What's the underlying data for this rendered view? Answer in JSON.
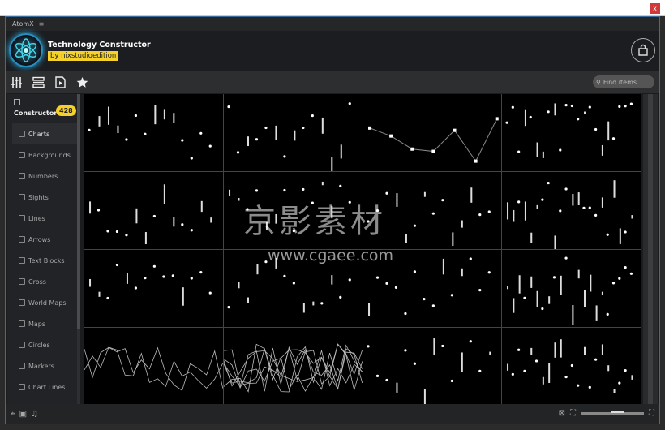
{
  "window": {
    "app_name": "AtomX",
    "menu_icon": "hamburger-icon",
    "close_label": "x"
  },
  "header": {
    "title": "Technology Constructor",
    "byline": "by nixstudioedition",
    "cart_icon": "shopping-bag-icon"
  },
  "toolbar": {
    "icons": [
      "sliders-icon",
      "list-icon",
      "media-file-icon",
      "star-icon"
    ],
    "search_placeholder": "Find items"
  },
  "sidebar": {
    "section": "Constructor",
    "count": "428",
    "items": [
      {
        "label": "Charts",
        "active": true
      },
      {
        "label": "Backgrounds"
      },
      {
        "label": "Numbers"
      },
      {
        "label": "Sights"
      },
      {
        "label": "Lines"
      },
      {
        "label": "Arrows"
      },
      {
        "label": "Text Blocks"
      },
      {
        "label": "Cross"
      },
      {
        "label": "World Maps"
      },
      {
        "label": "Maps"
      },
      {
        "label": "Circles"
      },
      {
        "label": "Markers"
      },
      {
        "label": "Chart Lines"
      }
    ]
  },
  "watermark": {
    "text": "京影素材",
    "url": "www.cgaee.com"
  },
  "colors": {
    "accent": "#f5d12a",
    "close": "#d0383a",
    "border": "#3b6d9c"
  }
}
